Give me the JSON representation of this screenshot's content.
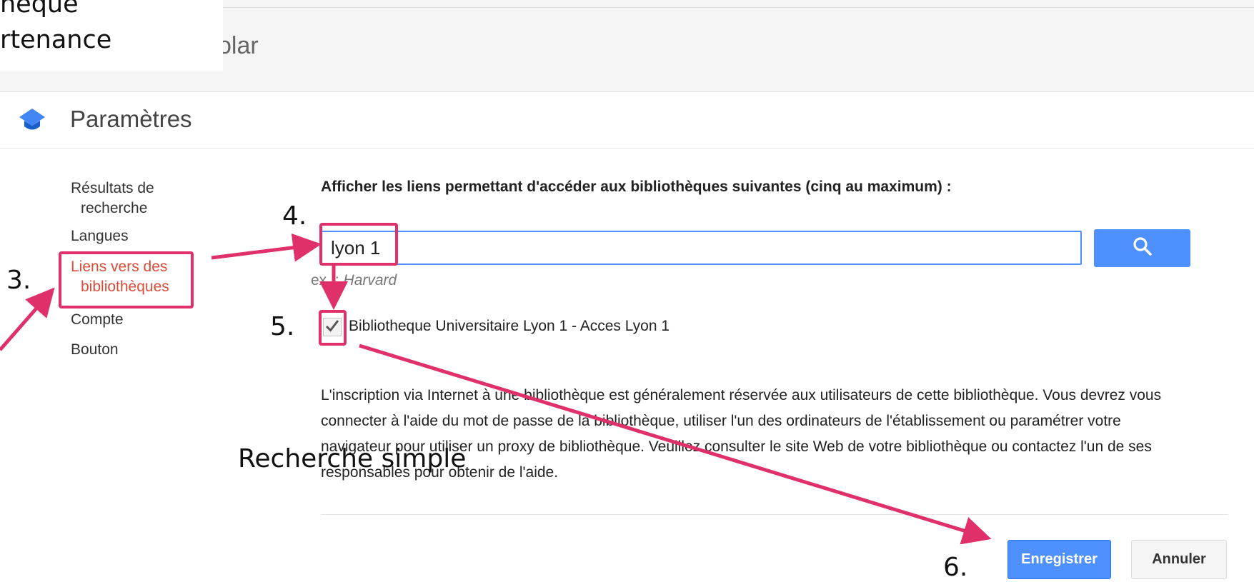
{
  "header": {
    "brand_fragment": "olar"
  },
  "overlay_caption": {
    "line1": "heque",
    "line2": "rtenance"
  },
  "settings": {
    "title": "Paramètres"
  },
  "sidebar": {
    "items": [
      {
        "label": "Résultats de\nrecherche"
      },
      {
        "label": "Langues"
      },
      {
        "label": "Liens vers des\nbibliothèques",
        "active": true
      },
      {
        "label": "Compte"
      },
      {
        "label": "Bouton"
      }
    ]
  },
  "main": {
    "heading": "Afficher les liens permettant d'accéder aux bibliothèques suivantes (cinq au maximum) :",
    "search": {
      "value": "lyon 1",
      "hint_prefix": "ex. :",
      "hint_value": "Harvard",
      "icon": "search-icon"
    },
    "result": {
      "checked": true,
      "label": "Bibliotheque Universitaire Lyon 1 - Acces Lyon 1"
    },
    "info": "L'inscription via Internet à une bibliothèque est généralement réservée aux utilisateurs de cette bibliothèque. Vous devrez vous connecter à l'aide du mot de passe de la bibliothèque, utiliser l'un des ordinateurs de l'établissement ou paramétrer votre navigateur pour utiliser un proxy de bibliothèque. Veuillez consulter le site Web de votre bibliothèque ou contactez l'un de ses responsables pour obtenir de l'aide."
  },
  "actions": {
    "save_label": "Enregistrer",
    "cancel_label": "Annuler"
  },
  "annotations": {
    "step3": "3.",
    "step4": "4.",
    "step5": "5.",
    "step6": "6.",
    "caption": "Recherche simple",
    "color": "#e0306a"
  },
  "colors": {
    "accent": "#4d90fe",
    "active_link": "#dd4b39",
    "annotation": "#e0306a"
  }
}
